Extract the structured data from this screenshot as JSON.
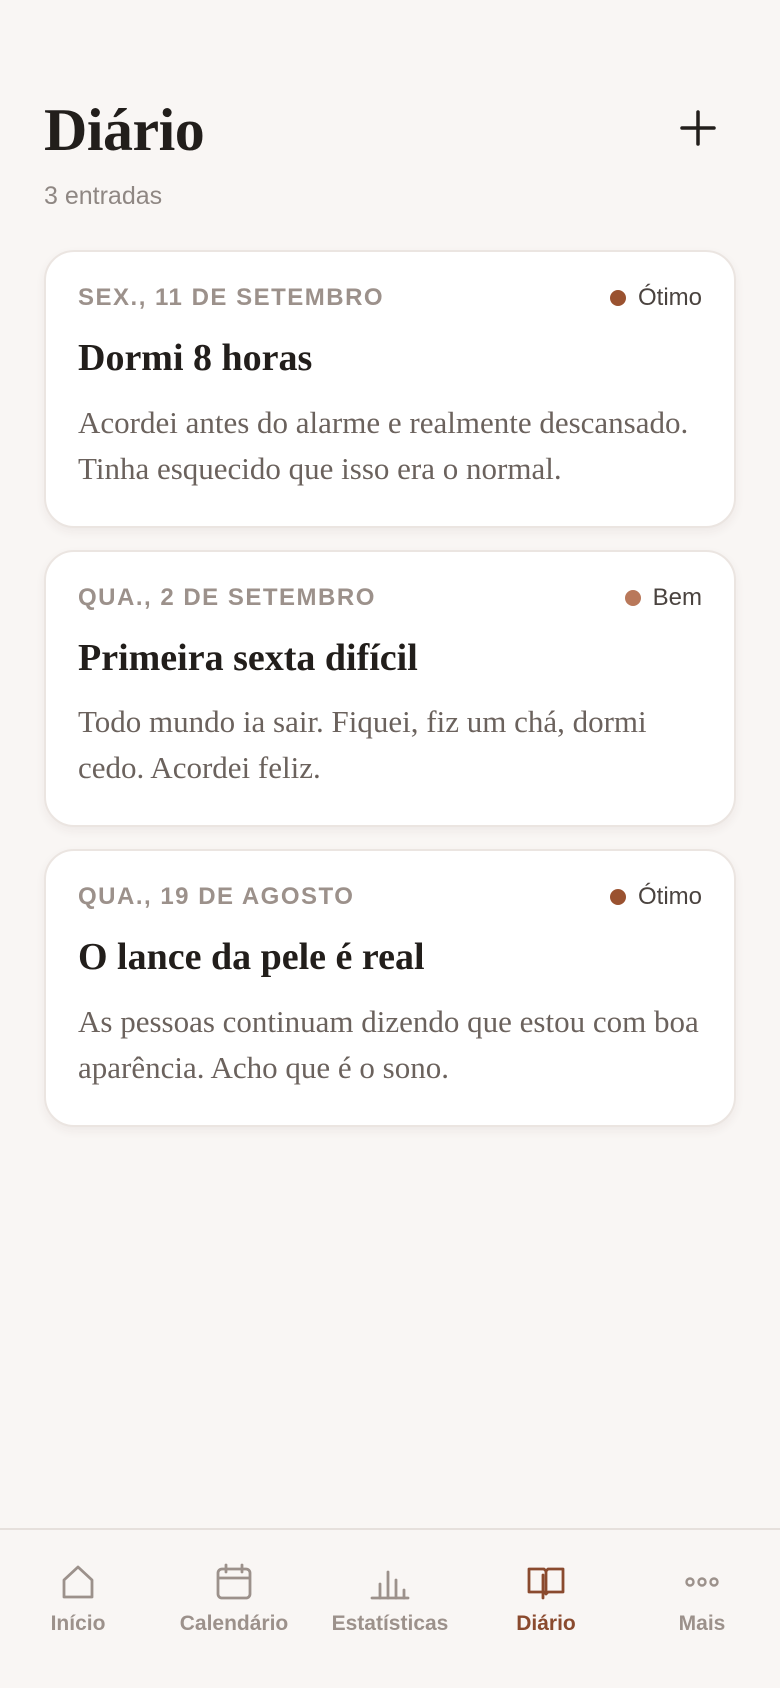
{
  "header": {
    "title": "Diário",
    "entry_count": "3 entradas",
    "add_icon": "plus-icon"
  },
  "entries": [
    {
      "date": "SEX., 11 DE SETEMBRO",
      "mood": "Ótimo",
      "mood_color": "#9a5230",
      "title": "Dormi 8 horas",
      "body": "Acordei antes do alarme e realmente descansado. Tinha esquecido que isso era o normal."
    },
    {
      "date": "QUA., 2 DE SETEMBRO",
      "mood": "Bem",
      "mood_color": "#b9785a",
      "title": "Primeira sexta difícil",
      "body": "Todo mundo ia sair. Fiquei, fiz um chá, dormi cedo. Acordei feliz."
    },
    {
      "date": "QUA., 19 DE AGOSTO",
      "mood": "Ótimo",
      "mood_color": "#9a5230",
      "title": "O lance da pele é real",
      "body": "As pessoas continuam dizendo que estou com boa aparência. Acho que é o sono."
    }
  ],
  "tabbar": {
    "active_color": "#8a4a2e",
    "inactive_color": "#9c918b",
    "tabs": [
      {
        "label": "Início",
        "icon": "home-icon",
        "active": false
      },
      {
        "label": "Calendário",
        "icon": "calendar-icon",
        "active": false
      },
      {
        "label": "Estatísticas",
        "icon": "bar-chart-icon",
        "active": false
      },
      {
        "label": "Diário",
        "icon": "book-icon",
        "active": true
      },
      {
        "label": "Mais",
        "icon": "more-icon",
        "active": false
      }
    ]
  }
}
